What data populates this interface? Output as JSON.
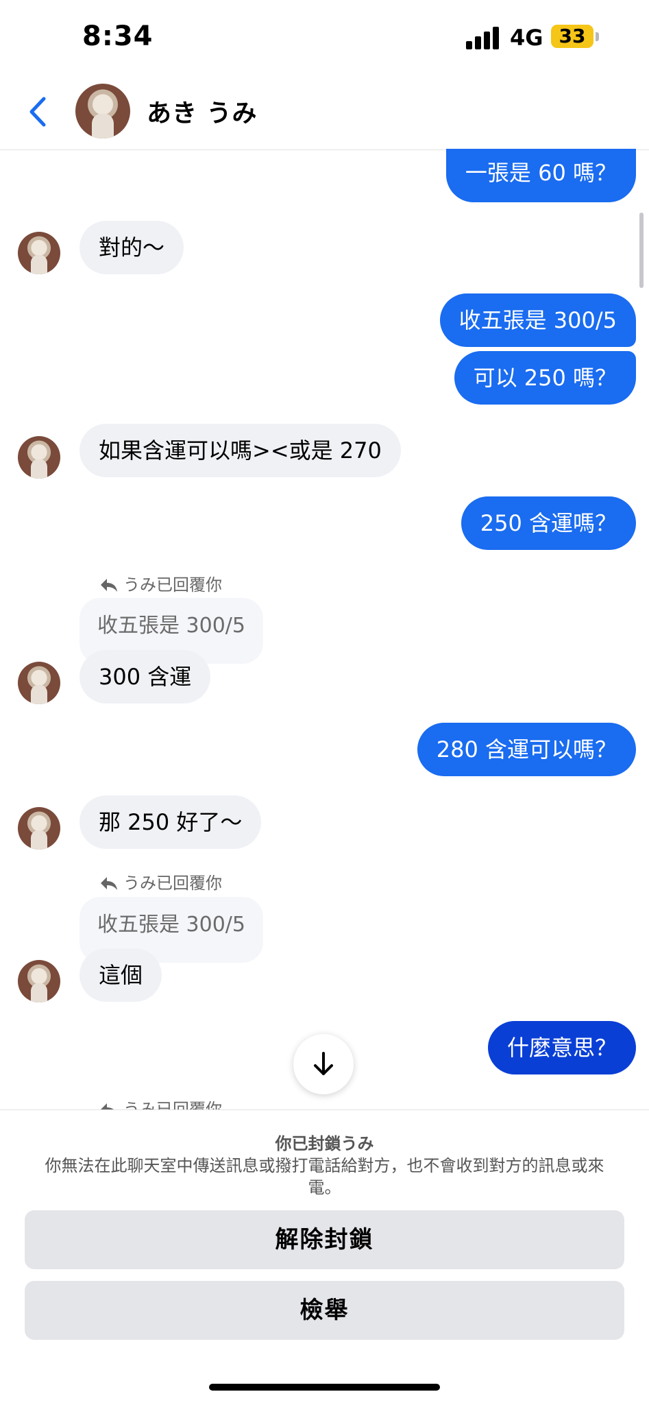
{
  "status_bar": {
    "time": "8:34",
    "network": "4G",
    "battery": "33"
  },
  "header": {
    "contact_name": "あき うみ"
  },
  "messages": [
    {
      "text": "一張是 60 嗎？"
    },
    {
      "text": "對的～"
    },
    {
      "text": "收五張是 300/5"
    },
    {
      "text": "可以 250 嗎？"
    },
    {
      "text": "如果含運可以嗎><或是 270"
    },
    {
      "text": "250 含運嗎？"
    },
    {
      "reply_label": "うみ已回覆你",
      "quote": "收五張是 300/5",
      "text": "300 含運"
    },
    {
      "text": "280 含運可以嗎？"
    },
    {
      "text": "那 250 好了～"
    },
    {
      "reply_label": "うみ已回覆你",
      "quote": "收五張是 300/5",
      "text": "這個"
    },
    {
      "text": "什麼意思？"
    },
    {
      "reply_label": "うみ已回覆你"
    }
  ],
  "footer": {
    "title": "你已封鎖うみ",
    "description": "你無法在此聊天室中傳送訊息或撥打電話給對方，也不會收到對方的訊息或來電。",
    "unblock_label": "解除封鎖",
    "report_label": "檢舉"
  },
  "colors": {
    "outgoing_bubble": "#1a6cf0",
    "incoming_bubble": "#f0f1f5",
    "accent": "#1a6cf0"
  },
  "icons": [
    "back-chevron-icon",
    "reply-icon",
    "arrow-down-icon"
  ]
}
